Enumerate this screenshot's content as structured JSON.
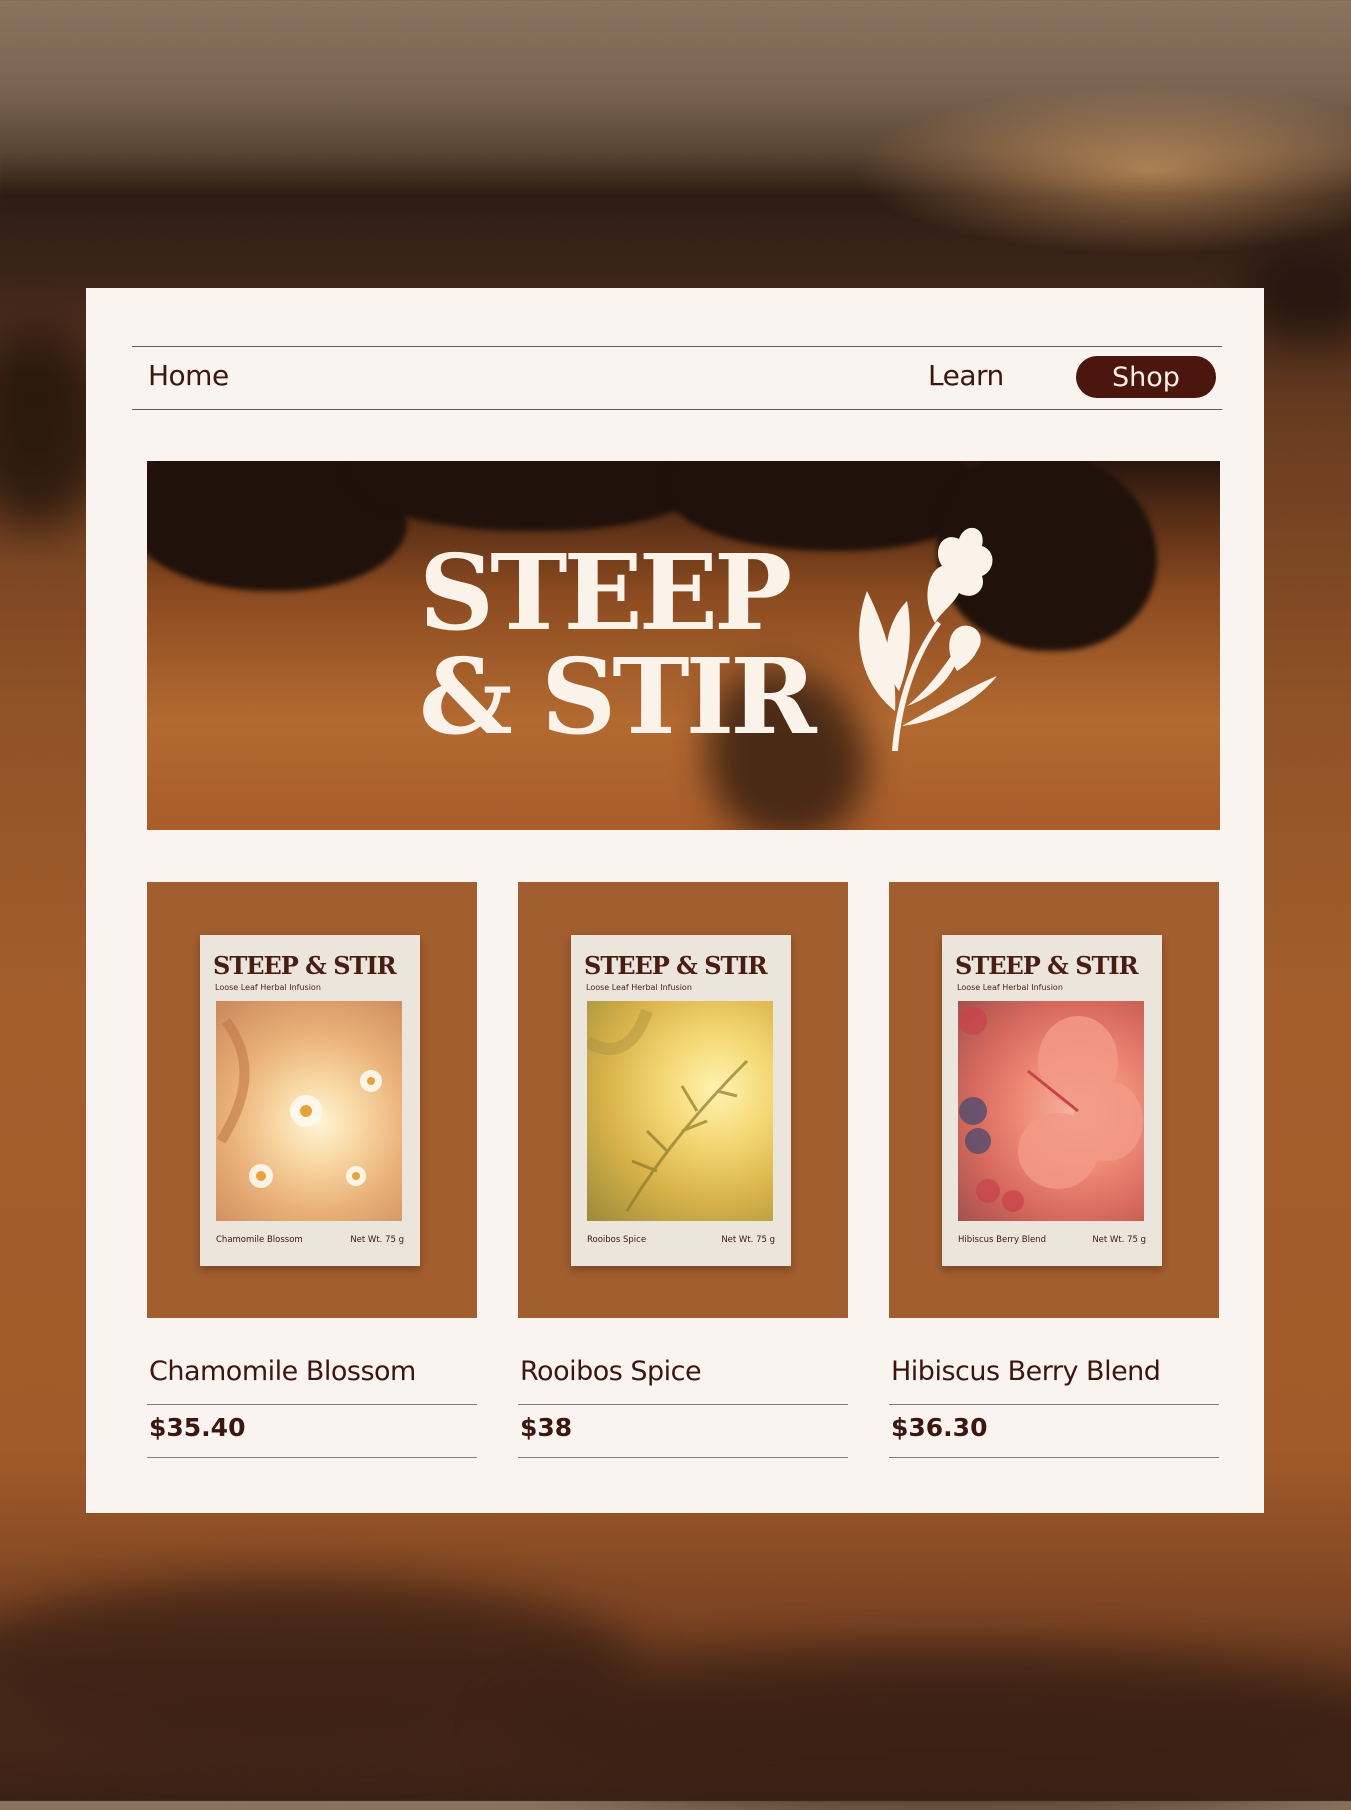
{
  "nav": {
    "home_label": "Home",
    "learn_label": "Learn",
    "shop_label": "Shop"
  },
  "hero": {
    "line1": "STEEP",
    "line2": "& STIR"
  },
  "products": [
    {
      "box_brand": "STEEP & STIR",
      "box_subtitle": "Loose Leaf Herbal Infusion",
      "box_name": "Chamomile Blossom",
      "box_weight": "Net Wt. 75 g",
      "name": "Chamomile Blossom",
      "price": "$35.40"
    },
    {
      "box_brand": "STEEP & STIR",
      "box_subtitle": "Loose Leaf Herbal Infusion",
      "box_name": "Rooibos Spice",
      "box_weight": "Net Wt. 75 g",
      "name": "Rooibos Spice",
      "price": "$38"
    },
    {
      "box_brand": "STEEP & STIR",
      "box_subtitle": "Loose Leaf Herbal Infusion",
      "box_name": "Hibiscus Berry Blend",
      "box_weight": "Net Wt. 75 g",
      "name": "Hibiscus Berry Blend",
      "price": "$36.30"
    }
  ],
  "colors": {
    "card_bg": "#f9f4f0",
    "text_dark": "#3b1710",
    "shop_button": "#4a160d",
    "product_bg": "#a35e2f"
  }
}
